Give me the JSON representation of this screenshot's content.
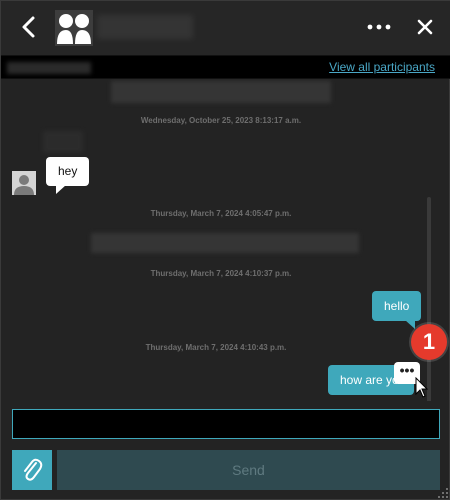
{
  "header": {
    "back_icon": "chevron-left-icon",
    "avatar_icon": "group-avatar-icon",
    "more_icon": "ellipsis-icon",
    "close_icon": "close-icon"
  },
  "participants": {
    "view_all_label": "View all participants"
  },
  "messages": {
    "timestamps": [
      "Wednesday, October 25, 2023 8:13:17 a.m.",
      "Thursday, March 7, 2024 4:05:47 p.m.",
      "Thursday, March 7, 2024 4:10:37 p.m.",
      "Thursday, March 7, 2024 4:10:43 p.m."
    ],
    "incoming": [
      {
        "text": "hey"
      }
    ],
    "outgoing": [
      {
        "text": "hello"
      },
      {
        "text": "how are yo"
      }
    ],
    "message_menu_label": "•••",
    "badge_number": "1"
  },
  "composer": {
    "input_value": "",
    "input_placeholder": "",
    "attach_icon": "paperclip-icon",
    "send_label": "Send"
  },
  "colors": {
    "accent": "#3fa8bb",
    "badge": "#e53a2c",
    "background": "#232323",
    "link": "#4aa7c6"
  }
}
